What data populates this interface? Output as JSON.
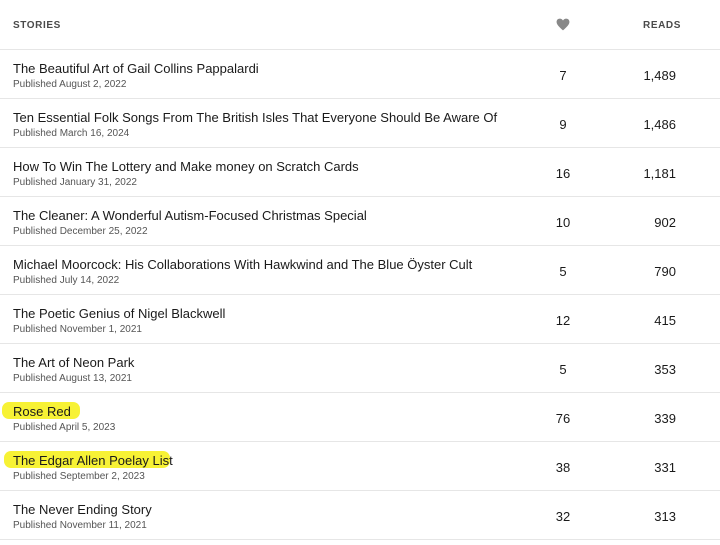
{
  "header": {
    "stories_label": "STORIES",
    "likes_icon": "heart-icon",
    "reads_label": "READS"
  },
  "highlight_color": "#f7f12a",
  "rows": [
    {
      "title": "The Beautiful Art of Gail Collins Pappalardi",
      "date": "Published August 2, 2022",
      "likes": "7",
      "reads": "1,489"
    },
    {
      "title": "Ten Essential Folk Songs From The British Isles That Everyone Should Be Aware Of",
      "date": "Published March 16, 2024",
      "likes": "9",
      "reads": "1,486"
    },
    {
      "title": "How To Win The Lottery and Make money on Scratch Cards",
      "date": "Published January 31, 2022",
      "likes": "16",
      "reads": "1,181"
    },
    {
      "title": "The Cleaner: A Wonderful Autism-Focused Christmas Special",
      "date": "Published December 25, 2022",
      "likes": "10",
      "reads": "902"
    },
    {
      "title": "Michael Moorcock: His Collaborations With Hawkwind and The Blue Öyster Cult",
      "date": "Published July 14, 2022",
      "likes": "5",
      "reads": "790"
    },
    {
      "title": "The Poetic Genius of Nigel Blackwell",
      "date": "Published November 1, 2021",
      "likes": "12",
      "reads": "415"
    },
    {
      "title": "The Art of Neon Park",
      "date": "Published August 13, 2021",
      "likes": "5",
      "reads": "353"
    },
    {
      "title": "Rose Red",
      "date": "Published April 5, 2023",
      "likes": "76",
      "reads": "339"
    },
    {
      "title": "The Edgar Allen Poelay List",
      "date": "Published September 2, 2023",
      "likes": "38",
      "reads": "331"
    },
    {
      "title": "The Never Ending Story",
      "date": "Published November 11, 2021",
      "likes": "32",
      "reads": "313"
    }
  ]
}
